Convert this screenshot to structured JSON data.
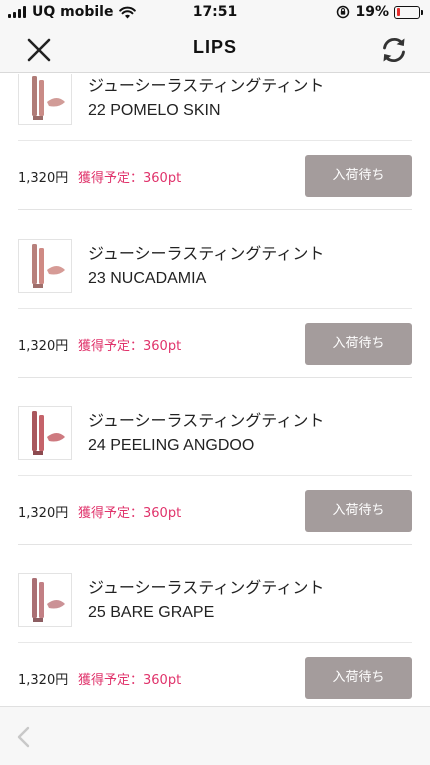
{
  "status_bar": {
    "carrier": "UQ mobile",
    "time": "17:51",
    "battery_percent": "19%",
    "battery_level": 0.19,
    "icons": [
      "signal-icon",
      "wifi-icon",
      "orientation-lock-icon",
      "battery-icon"
    ]
  },
  "nav": {
    "title": "LIPS",
    "close_icon": "close-icon",
    "refresh_icon": "refresh-icon"
  },
  "colors": {
    "points": "#e0336b",
    "button_bg": "#a49c9c",
    "battery_low": "#e52d2d"
  },
  "products": [
    {
      "name": "ジューシーラスティングティント",
      "shade": "22 POMELO SKIN",
      "price": "1,320円",
      "points": "獲得予定：360pt",
      "button": "入荷待ち",
      "swatch": "#c98b86"
    },
    {
      "name": "ジューシーラスティングティント",
      "shade": "23 NUCADAMIA",
      "price": "1,320円",
      "points": "獲得予定：360pt",
      "button": "入荷待ち",
      "swatch": "#cf8a84"
    },
    {
      "name": "ジューシーラスティングティント",
      "shade": "24 PEELING ANGDOO",
      "price": "1,320円",
      "points": "獲得予定：360pt",
      "button": "入荷待ち",
      "swatch": "#c5636a"
    },
    {
      "name": "ジューシーラスティングティント",
      "shade": "25 BARE GRAPE",
      "price": "1,320円",
      "points": "獲得予定：360pt",
      "button": "入荷待ち",
      "swatch": "#c27f84"
    }
  ],
  "toolbar": {
    "back_icon": "back-arrow-icon"
  }
}
